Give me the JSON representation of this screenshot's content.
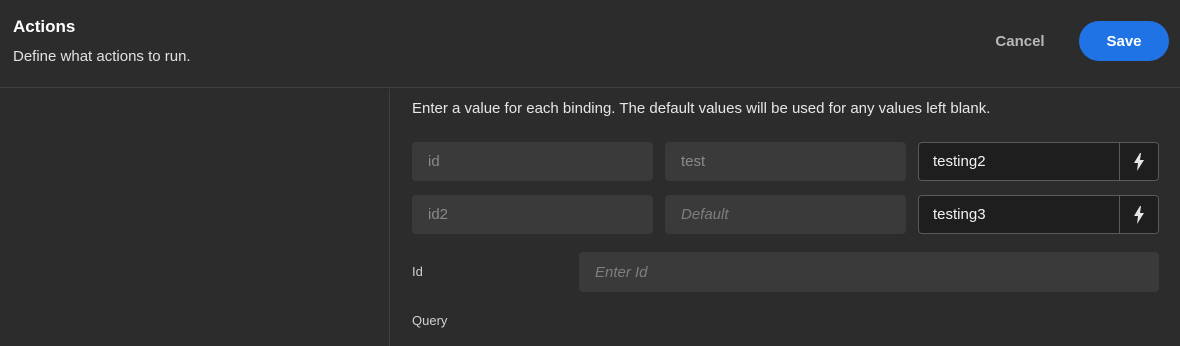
{
  "header": {
    "title": "Actions",
    "subtitle": "Define what actions to run.",
    "cancel_label": "Cancel",
    "save_label": "Save"
  },
  "main": {
    "description": "Enter a value for each binding. The default values will be used for any values left blank.",
    "bindings": [
      {
        "name": "id",
        "default": "test",
        "value": "testing2",
        "icon": "lightning-bolt-icon"
      },
      {
        "name": "id2",
        "default": "Default",
        "value": "testing3",
        "icon": "lightning-bolt-icon"
      }
    ],
    "id_label": "Id",
    "id_placeholder": "Enter Id",
    "query_label": "Query"
  },
  "colors": {
    "background": "#2c2c2c",
    "accent": "#1f73e5",
    "field": "#3a3a3a"
  }
}
